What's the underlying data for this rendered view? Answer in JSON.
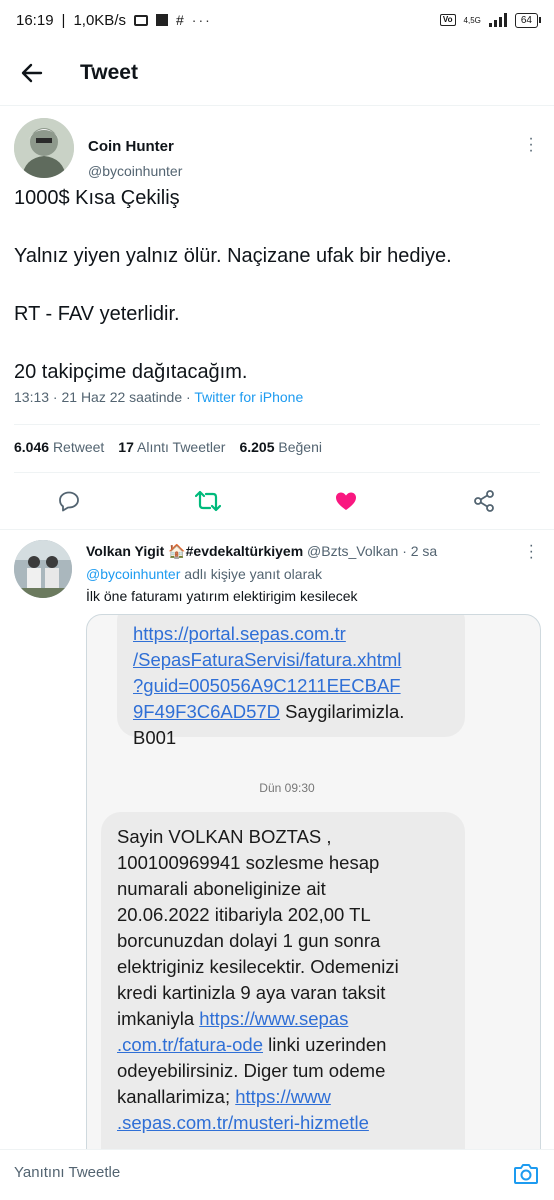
{
  "status_bar": {
    "time": "16:19",
    "network": "1,0KB/s",
    "signal_label": "4,5G",
    "battery": "64"
  },
  "header": {
    "title": "Tweet"
  },
  "tweet": {
    "author_name": "Coin Hunter",
    "author_handle": "@bycoinhunter",
    "text_lines": [
      "1000$ Kısa Çekiliş",
      "Yalnız yiyen yalnız ölür. Naçizane ufak bir hediye.",
      "RT - FAV yeterlidir.",
      "20 takipçime dağıtacağım."
    ],
    "time": "13:13 · 21 Haz 22 saatinde · ",
    "source": "Twitter for iPhone",
    "retweets": "6.046",
    "retweets_label": "Retweet",
    "quotes": "17",
    "quotes_label": "Alıntı Tweetler",
    "likes": "6.205",
    "likes_label": "Beğeni"
  },
  "reply": {
    "name": "Volkan Yigit 🏠#evdekaltürkiyem",
    "handle": "@Bzts_Volkan · 2 sa",
    "replying_mention": "@bycoinhunter",
    "replying_suffix": " adlı kişiye yanıt olarak",
    "text": "İlk öne faturamı yatırım elektirigim kesilecek",
    "image": {
      "bubble1": {
        "link1": "https://portal.sepas.com.tr",
        "link2": "/SepasFaturaServisi/fatura.xhtml",
        "link3": "?guid=005056A9C1211EECBAF",
        "link4": "9F49F3C6AD57D",
        "after_link": " Saygilarimizla.",
        "last": "B001"
      },
      "timestamp": "Dün 09:30",
      "bubble2": {
        "l1": "Sayin VOLKAN BOZTAS ,",
        "l2": "100100969941 sozlesme hesap",
        "l3": "numarali aboneliginize ait",
        "l4": "20.06.2022 itibariyla 202,00 TL",
        "l5": "borcunuzdan dolayi 1 gun sonra",
        "l6": "elektriginiz kesilecektir. Odemenizi",
        "l7": "kredi kartinizla 9 aya varan taksit",
        "l8_pre": "imkaniyla ",
        "l8_link": "https://www.sepas",
        "l9_link": ".com.tr/fatura-ode",
        "l9_post": " linki uzerinden",
        "l10": "odeyebilirsiniz. Diger tum odeme",
        "l11_pre": "kanallarimiza; ",
        "l11_link": "https://www",
        "l12_link": ".sepas.com.tr/musteri-hizmetle"
      }
    }
  },
  "composer": {
    "placeholder": "Yanıtını Tweetle"
  },
  "colors": {
    "accent": "#1d9bf0",
    "retweet": "#00ba7c",
    "like": "#f91880"
  }
}
